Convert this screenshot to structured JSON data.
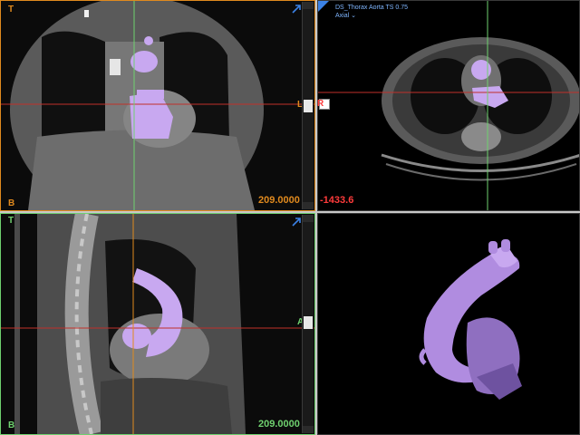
{
  "viewports": {
    "coronal": {
      "orient_top": "T",
      "orient_bottom": "B",
      "orient_left": "L",
      "orient_right": "R",
      "readout": "209.0000",
      "accent": "#e08a1e"
    },
    "axial": {
      "series_title": "DS_Thorax Aorta TS 0.75",
      "plane_label": "Axial",
      "readout": "-1433.6",
      "readout_color": "#ff3b3b"
    },
    "sagittal": {
      "orient_top": "T",
      "orient_bottom": "B",
      "orient_right": "A",
      "readout": "209.0000",
      "accent": "#6fd16f"
    },
    "volume3d": {
      "object": "aorta-segmentation"
    }
  },
  "icons": {
    "maximize": "maximize-icon",
    "dropdown": "chevron-down-icon"
  },
  "colors": {
    "segmentation": "#c8a8f0",
    "crosshair_h": "#c0302a",
    "crosshair_v": "#6fd16f",
    "crosshair_v_sag": "#e08a1e"
  }
}
